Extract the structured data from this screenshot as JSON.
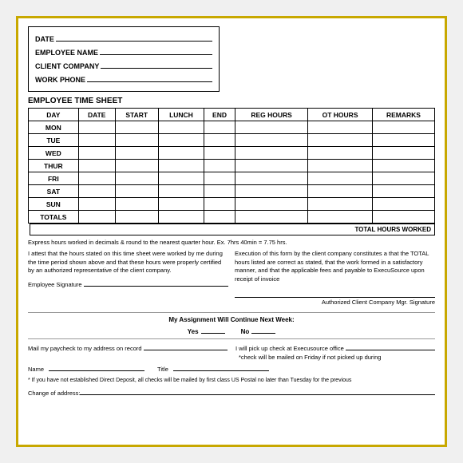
{
  "header": {
    "date_label": "DATE",
    "employee_name_label": "EMPLOYEE NAME",
    "client_company_label": "CLIENT COMPANY",
    "work_phone_label": "WORK PHONE"
  },
  "section_title": "EMPLOYEE TIME SHEET",
  "table": {
    "columns": [
      "DAY",
      "DATE",
      "START",
      "LUNCH",
      "END",
      "REG HOURS",
      "OT HOURS",
      "REMARKS"
    ],
    "rows": [
      {
        "day": "MON"
      },
      {
        "day": "TUE"
      },
      {
        "day": "WED"
      },
      {
        "day": "THUR"
      },
      {
        "day": "FRI"
      },
      {
        "day": "SAT"
      },
      {
        "day": "SUN"
      },
      {
        "day": "TOTALS"
      }
    ],
    "total_label": "TOTAL HOURS WORKED"
  },
  "note": "Express hours worked in decimals & round to the nearest quarter hour.  Ex.  7hrs 40min = 7.75 hrs.",
  "attestation": {
    "left_text": "I attest that the hours stated on this time sheet were worked by me during the time period shown above and that these hours were properly certified by an authorized representative of the client company.",
    "left_sig_label": "Employee Signature",
    "right_text": "Execution of this form by the client company constitutes a that the TOTAL hours listed are correct as stated, that the work formed in a satisfactory manner, and that the applicable fees and payable to ExecuSource upon receipt of invoice",
    "right_sig_label": "Authorized Client Company Mgr. Signature"
  },
  "assignment": {
    "label": "My Assignment Will Continue Next Week:",
    "yes_label": "Yes",
    "no_label": "No"
  },
  "bottom": {
    "mail_label": "Mail my paycheck to my address on record",
    "pickup_label": "I will pick up check at Execusource office",
    "check_note": "*check will be mailed on Friday if not picked up during",
    "name_label": "Name",
    "title_label": "Title"
  },
  "fine_print": "* If you have not established Direct Deposit, all checks will be mailed by first class US Postal no later than Tuesday for the previous",
  "change_label": "Change of address:"
}
